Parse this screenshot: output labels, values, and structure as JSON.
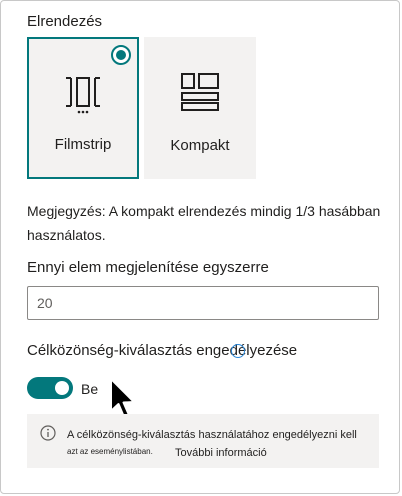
{
  "panel": {
    "layout_title": "Elrendezés",
    "layouts": [
      {
        "label": "Filmstrip",
        "icon": "filmstrip-icon",
        "selected": true
      },
      {
        "label": "Kompakt",
        "icon": "compact-grid-icon",
        "selected": false
      }
    ],
    "note": "Megjegyzés: A kompakt elrendezés mindig 1/3 hasábban használatos.",
    "items_label": "Ennyi elem megjelenítése egyszerre",
    "items_value": "20",
    "audience_label": "Célközönség-kiválasztás engedélyezése",
    "toggle_state": "Be",
    "toggle_on": true,
    "info_line1": "A célközönség-kiválasztás használatához engedélyezni kell",
    "info_line2": "azt az eseménylistában.",
    "info_link": "További információ"
  },
  "colors": {
    "accent": "#03787c",
    "card_bg": "#f3f2f1",
    "text": "#201f1e"
  }
}
